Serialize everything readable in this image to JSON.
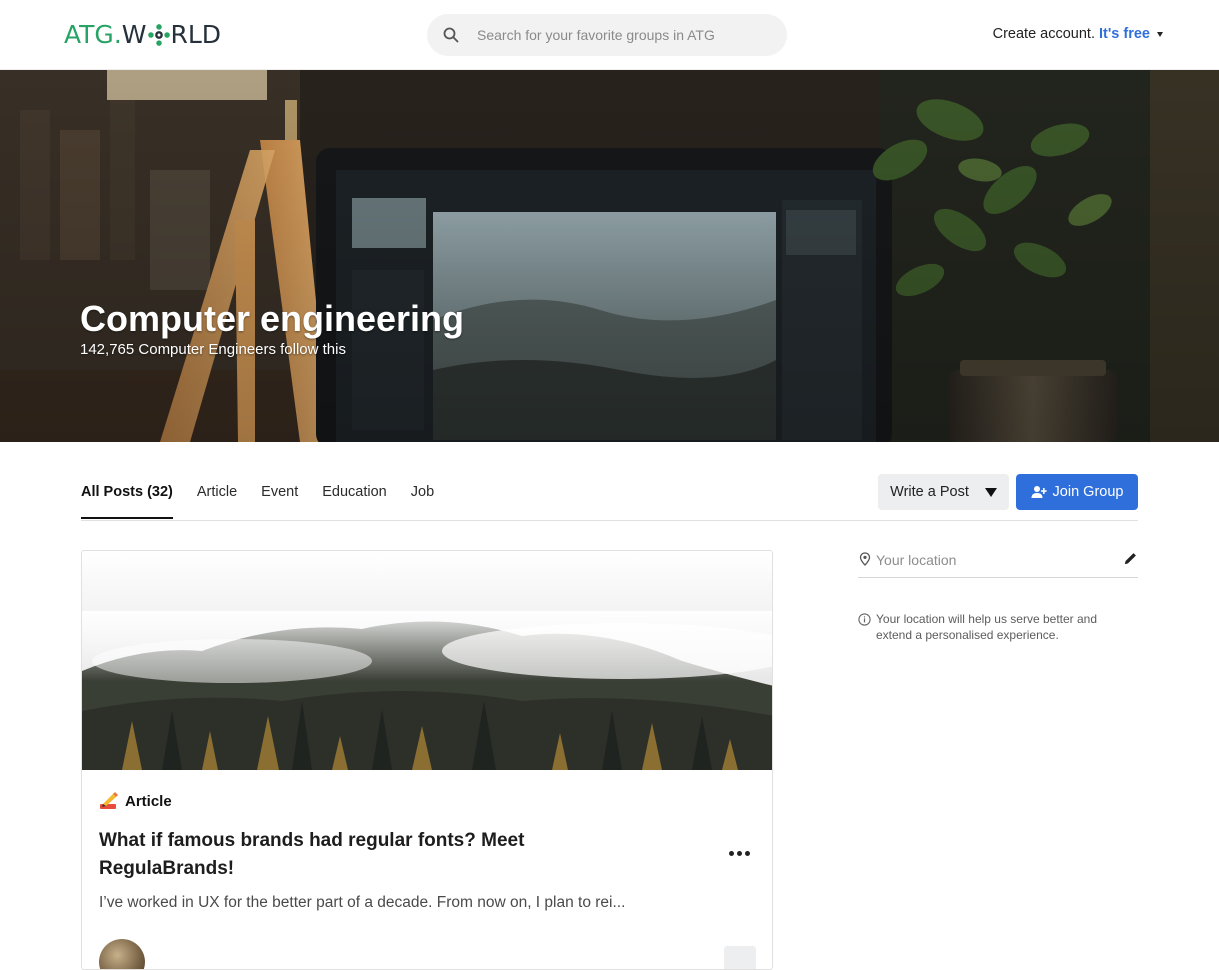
{
  "header": {
    "logo": {
      "part1": "ATG",
      "dot": ".",
      "part2_prefix": "W",
      "part2_suffix": "RLD"
    },
    "search_placeholder": "Search for your favorite groups in ATG",
    "create_account": "Create account.",
    "its_free": "It's free"
  },
  "hero": {
    "title": "Computer engineering",
    "subtitle": "142,765 Computer Engineers follow this"
  },
  "tabs": [
    {
      "label": "All Posts (32)",
      "active": true
    },
    {
      "label": "Article"
    },
    {
      "label": "Event"
    },
    {
      "label": "Education"
    },
    {
      "label": "Job"
    }
  ],
  "actions": {
    "write_post": "Write a Post",
    "join_group": "Join Group"
  },
  "post": {
    "type_emoji": "✍️",
    "type_label": "Article",
    "title": "What if famous brands had regular fonts? Meet RegulaBrands!",
    "excerpt": "I’ve worked in UX for the better part of a decade. From now on, I plan to rei..."
  },
  "sidebar": {
    "location_placeholder": "Your location",
    "info_text": "Your location will help us serve better and extend a personalised experience."
  },
  "colors": {
    "brand_green": "#27a365",
    "primary_blue": "#2f6fdc",
    "button_gray": "#edeef0"
  }
}
